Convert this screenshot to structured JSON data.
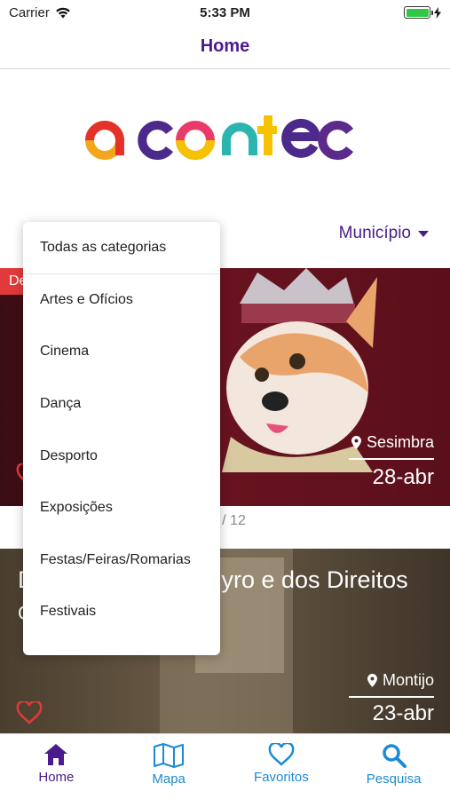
{
  "status_bar": {
    "carrier": "Carrier",
    "time": "5:33 PM"
  },
  "nav": {
    "title": "Home"
  },
  "logo": {
    "text": "acontece",
    "letter_colors": [
      "#f3a61a",
      "#e4322b",
      "#4b2a8c",
      "#e83a6b",
      "#2bb5b0",
      "#f6c200",
      "#4b2a8c",
      "#5b2a8c"
    ]
  },
  "filter": {
    "municipio_label": "Município"
  },
  "dropdown": {
    "items": [
      "Todas as categorias",
      "Artes e Ofícios",
      "Cinema",
      "Dança",
      "Desporto",
      "Exposições",
      "Festas/Feiras/Romarias",
      "Festivais"
    ]
  },
  "card1": {
    "badge": "De",
    "location": "Sesimbra",
    "date": "28-abr"
  },
  "pager": {
    "text": "/ 12"
  },
  "card2": {
    "title": "D",
    "title_tail": "yro e dos Direitos",
    "subtitle": "C",
    "location": "Montijo",
    "date": "23-abr"
  },
  "tabs": [
    {
      "label": "Home",
      "icon": "home-icon",
      "active": true
    },
    {
      "label": "Mapa",
      "icon": "map-icon",
      "active": false
    },
    {
      "label": "Favoritos",
      "icon": "heart-icon",
      "active": false
    },
    {
      "label": "Pesquisa",
      "icon": "search-icon",
      "active": false
    }
  ],
  "colors": {
    "primary": "#4b1a8c",
    "tab_inactive": "#1c8ad4",
    "badge": "#e23a3a"
  }
}
